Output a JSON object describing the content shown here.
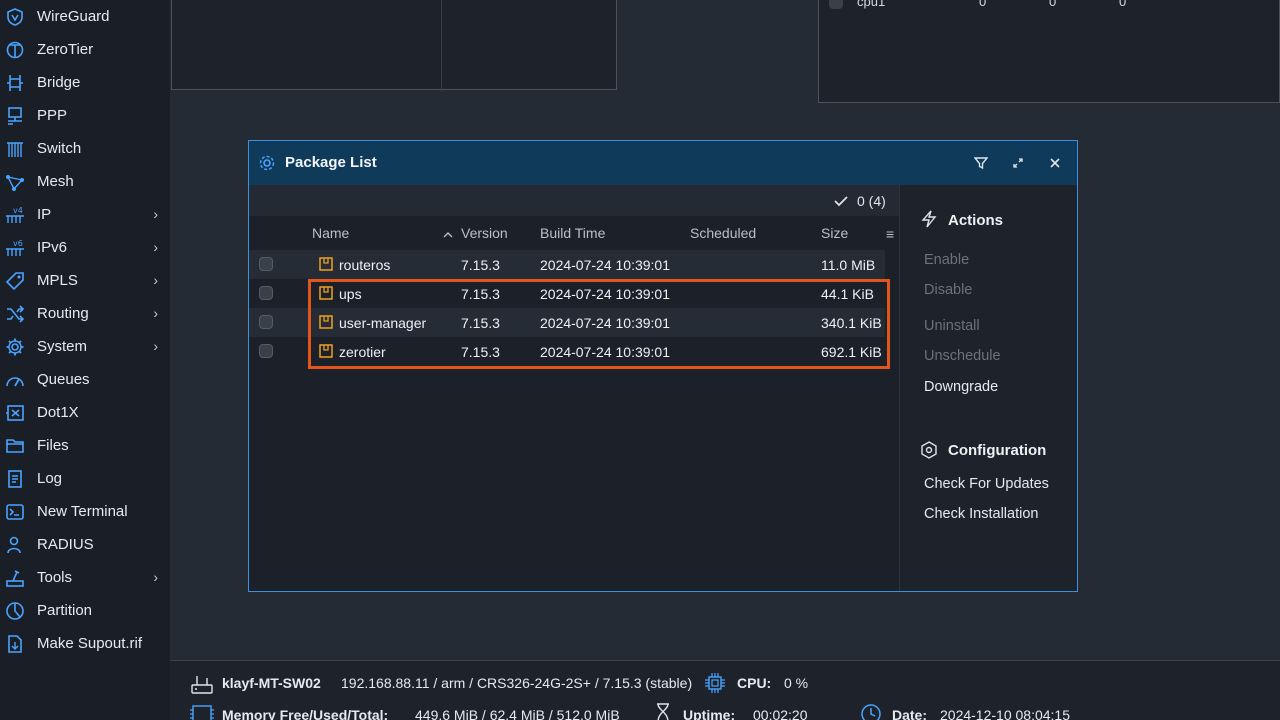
{
  "sidebar": {
    "items": [
      {
        "label": "WireGuard",
        "icon": "wireguard-icon",
        "has_submenu": false
      },
      {
        "label": "ZeroTier",
        "icon": "zerotier-icon",
        "has_submenu": false
      },
      {
        "label": "Bridge",
        "icon": "bridge-icon",
        "has_submenu": false
      },
      {
        "label": "PPP",
        "icon": "ppp-icon",
        "has_submenu": false
      },
      {
        "label": "Switch",
        "icon": "switch-icon",
        "has_submenu": false
      },
      {
        "label": "Mesh",
        "icon": "mesh-icon",
        "has_submenu": false
      },
      {
        "label": "IP",
        "icon": "ipv4-icon",
        "has_submenu": true
      },
      {
        "label": "IPv6",
        "icon": "ipv6-icon",
        "has_submenu": true
      },
      {
        "label": "MPLS",
        "icon": "mpls-icon",
        "has_submenu": true
      },
      {
        "label": "Routing",
        "icon": "routing-icon",
        "has_submenu": true
      },
      {
        "label": "System",
        "icon": "system-gear-icon",
        "has_submenu": true
      },
      {
        "label": "Queues",
        "icon": "queues-icon",
        "has_submenu": false
      },
      {
        "label": "Dot1X",
        "icon": "dot1x-icon",
        "has_submenu": false
      },
      {
        "label": "Files",
        "icon": "folder-icon",
        "has_submenu": false
      },
      {
        "label": "Log",
        "icon": "log-icon",
        "has_submenu": false
      },
      {
        "label": "New Terminal",
        "icon": "terminal-icon",
        "has_submenu": false
      },
      {
        "label": "RADIUS",
        "icon": "radius-icon",
        "has_submenu": false
      },
      {
        "label": "Tools",
        "icon": "tools-icon",
        "has_submenu": true
      },
      {
        "label": "Partition",
        "icon": "partition-icon",
        "has_submenu": false
      },
      {
        "label": "Make Supout.rif",
        "icon": "supout-icon",
        "has_submenu": false
      }
    ]
  },
  "background": {
    "cpu_row": {
      "name": "cpu1",
      "v1": "0",
      "v2": "0",
      "v3": "0"
    }
  },
  "dialog": {
    "title": "Package List",
    "selection_count": "0 (4)",
    "columns": {
      "name": "Name",
      "version": "Version",
      "build_time": "Build Time",
      "scheduled": "Scheduled",
      "size": "Size"
    },
    "packages": [
      {
        "name": "routeros",
        "version": "7.15.3",
        "build_time": "2024-07-24 10:39:01",
        "scheduled": "",
        "size": "11.0 MiB"
      },
      {
        "name": "ups",
        "version": "7.15.3",
        "build_time": "2024-07-24 10:39:01",
        "scheduled": "",
        "size": "44.1 KiB"
      },
      {
        "name": "user-manager",
        "version": "7.15.3",
        "build_time": "2024-07-24 10:39:01",
        "scheduled": "",
        "size": "340.1 KiB"
      },
      {
        "name": "zerotier",
        "version": "7.15.3",
        "build_time": "2024-07-24 10:39:01",
        "scheduled": "",
        "size": "692.1 KiB"
      }
    ],
    "actions": {
      "heading": "Actions",
      "enable": "Enable",
      "disable": "Disable",
      "uninstall": "Uninstall",
      "unschedule": "Unschedule",
      "downgrade": "Downgrade"
    },
    "configuration": {
      "heading": "Configuration",
      "check_updates": "Check For Updates",
      "check_installation": "Check Installation"
    }
  },
  "statusbar": {
    "identity": "klayf-MT-SW02",
    "device_info": "192.168.88.11 / arm / CRS326-24G-2S+ / 7.15.3 (stable)",
    "cpu_label": "CPU:",
    "cpu_value": "0 %",
    "memory_label": "Memory Free/Used/Total:",
    "memory_value": "449.6 MiB / 62.4 MiB / 512.0 MiB",
    "uptime_label": "Uptime:",
    "uptime_value": "00:02:20",
    "date_label": "Date:",
    "date_value": "2024-12-10 08:04:15"
  },
  "colors": {
    "accent": "#3f8ee0",
    "highlight": "#e2561b",
    "package_icon": "#f0a020",
    "header_bg": "#0f3a5a"
  }
}
